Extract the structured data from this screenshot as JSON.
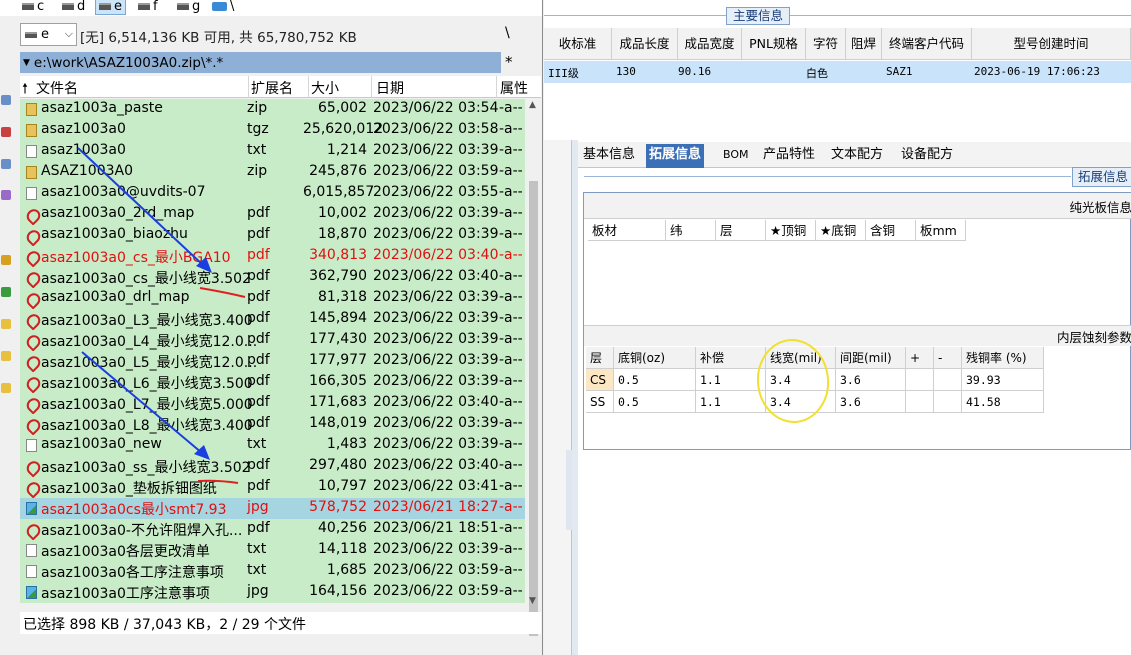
{
  "drives": [
    {
      "letter": "c"
    },
    {
      "letter": "d"
    },
    {
      "letter": "e"
    },
    {
      "letter": "f"
    },
    {
      "letter": "g"
    },
    {
      "letter": "\\"
    }
  ],
  "drive_combo": {
    "value": "e"
  },
  "drive_free": "[无] 6,514,136 KB 可用, 共 65,780,752 KB",
  "root_button": "\\",
  "up_button": "*",
  "path": "e:\\work\\ASAZ1003A0.zip\\*.*",
  "columns": {
    "name": "文件名",
    "ext": "扩展名",
    "size": "大小",
    "date": "日期",
    "attr": "属性"
  },
  "files": [
    {
      "name": "asaz1003a_paste",
      "ext": "zip",
      "size": "65,002",
      "date": "2023/06/22 03:54",
      "attr": "-a--",
      "icon": "zip"
    },
    {
      "name": "asaz1003a0",
      "ext": "tgz",
      "size": "25,620,012",
      "date": "2023/06/22 03:58",
      "attr": "-a--",
      "icon": "zip"
    },
    {
      "name": "asaz1003a0",
      "ext": "txt",
      "size": "1,214",
      "date": "2023/06/22 03:39",
      "attr": "-a--",
      "icon": "txt"
    },
    {
      "name": "ASAZ1003A0",
      "ext": "zip",
      "size": "245,876",
      "date": "2023/06/22 03:59",
      "attr": "-a--",
      "icon": "zip"
    },
    {
      "name": "asaz1003a0@uvdits-07",
      "ext": "",
      "size": "6,015,857",
      "date": "2023/06/22 03:55",
      "attr": "-a--",
      "icon": "txt"
    },
    {
      "name": "asaz1003a0_2rd_map",
      "ext": "pdf",
      "size": "10,002",
      "date": "2023/06/22 03:39",
      "attr": "-a--",
      "icon": "pdf"
    },
    {
      "name": "asaz1003a0_biaozhu",
      "ext": "pdf",
      "size": "18,870",
      "date": "2023/06/22 03:39",
      "attr": "-a--",
      "icon": "pdf"
    },
    {
      "name": "asaz1003a0_cs_最小BGA10",
      "ext": "pdf",
      "size": "340,813",
      "date": "2023/06/22 03:40",
      "attr": "-a--",
      "icon": "pdf",
      "red": true
    },
    {
      "name": "asaz1003a0_cs_最小线宽3.502",
      "ext": "pdf",
      "size": "362,790",
      "date": "2023/06/22 03:40",
      "attr": "-a--",
      "icon": "pdf"
    },
    {
      "name": "asaz1003a0_drl_map",
      "ext": "pdf",
      "size": "81,318",
      "date": "2023/06/22 03:39",
      "attr": "-a--",
      "icon": "pdf"
    },
    {
      "name": "asaz1003a0_L3_最小线宽3.400",
      "ext": "pdf",
      "size": "145,894",
      "date": "2023/06/22 03:39",
      "attr": "-a--",
      "icon": "pdf"
    },
    {
      "name": "asaz1003a0_L4_最小线宽12.0...",
      "ext": "pdf",
      "size": "177,430",
      "date": "2023/06/22 03:39",
      "attr": "-a--",
      "icon": "pdf"
    },
    {
      "name": "asaz1003a0_L5_最小线宽12.0...",
      "ext": "pdf",
      "size": "177,977",
      "date": "2023/06/22 03:39",
      "attr": "-a--",
      "icon": "pdf"
    },
    {
      "name": "asaz1003a0_L6_最小线宽3.500",
      "ext": "pdf",
      "size": "166,305",
      "date": "2023/06/22 03:39",
      "attr": "-a--",
      "icon": "pdf"
    },
    {
      "name": "asaz1003a0_L7_最小线宽5.000",
      "ext": "pdf",
      "size": "171,683",
      "date": "2023/06/22 03:40",
      "attr": "-a--",
      "icon": "pdf"
    },
    {
      "name": "asaz1003a0_L8_最小线宽3.400",
      "ext": "pdf",
      "size": "148,019",
      "date": "2023/06/22 03:39",
      "attr": "-a--",
      "icon": "pdf"
    },
    {
      "name": "asaz1003a0_new",
      "ext": "txt",
      "size": "1,483",
      "date": "2023/06/22 03:39",
      "attr": "-a--",
      "icon": "txt"
    },
    {
      "name": "asaz1003a0_ss_最小线宽3.502",
      "ext": "pdf",
      "size": "297,480",
      "date": "2023/06/22 03:40",
      "attr": "-a--",
      "icon": "pdf"
    },
    {
      "name": "asaz1003a0_垫板拆钿图纸",
      "ext": "pdf",
      "size": "10,797",
      "date": "2023/06/22 03:41",
      "attr": "-a--",
      "icon": "pdf"
    },
    {
      "name": "asaz1003a0cs最小smt7.93",
      "ext": "jpg",
      "size": "578,752",
      "date": "2023/06/21 18:27",
      "attr": "-a--",
      "icon": "jpg",
      "red": true,
      "highlight": true
    },
    {
      "name": "asaz1003a0-不允许阻焊入孔...",
      "ext": "pdf",
      "size": "40,256",
      "date": "2023/06/21 18:51",
      "attr": "-a--",
      "icon": "pdf"
    },
    {
      "name": "asaz1003a0各层更改清单",
      "ext": "txt",
      "size": "14,118",
      "date": "2023/06/22 03:39",
      "attr": "-a--",
      "icon": "txt"
    },
    {
      "name": "asaz1003a0各工序注意事项",
      "ext": "txt",
      "size": "1,685",
      "date": "2023/06/22 03:59",
      "attr": "-a--",
      "icon": "txt"
    },
    {
      "name": "asaz1003a0工序注意事项",
      "ext": "jpg",
      "size": "164,156",
      "date": "2023/06/22 03:59",
      "attr": "-a--",
      "icon": "jpg"
    }
  ],
  "status": "已选择 898 KB / 37,043 KB，2 / 29 个文件",
  "erp": {
    "main_info_label": "主要信息",
    "top_headers": [
      "收标准",
      "成品长度",
      "成品宽度",
      "PNL规格",
      "字符",
      "阻焊",
      "终端客户代码",
      "型号创建时间"
    ],
    "top_row": [
      "III级",
      "130",
      "90.16",
      "",
      "白色",
      "",
      "SAZ1",
      "2023-06-19 17:06:23"
    ],
    "tabs": [
      "基本信息",
      "拓展信息",
      "BOM",
      "产品特性",
      "文本配方",
      "设备配方"
    ],
    "active_tab": 1,
    "ext_label": "拓展信息",
    "section1_title": "纯光板信息",
    "section1_headers": [
      "板材",
      "纬",
      "层",
      "★顶铜",
      "★底铜",
      "含铜",
      "板mm"
    ],
    "section2_title": "内层蚀刻参数",
    "etch_headers": [
      "层",
      "底铜(oz)",
      "补偿",
      "线宽(mil)",
      "间距(mil)",
      "+",
      "-",
      "残铜率 (%)"
    ],
    "etch_rows": [
      [
        "CS",
        "0.5",
        "1.1",
        "3.4",
        "3.6",
        "",
        "",
        "39.93"
      ],
      [
        "SS",
        "0.5",
        "1.1",
        "3.4",
        "3.6",
        "",
        "",
        "41.58"
      ]
    ]
  },
  "colors": {
    "row_green": "#c8ecc8",
    "row_highlight": "#a5d5e0",
    "red_text": "#e01010",
    "tab_active": "#3b6fb6",
    "annotation_blue": "#1a3ee0",
    "annotation_red": "#e02020",
    "annotation_yellow": "#f0e030"
  }
}
